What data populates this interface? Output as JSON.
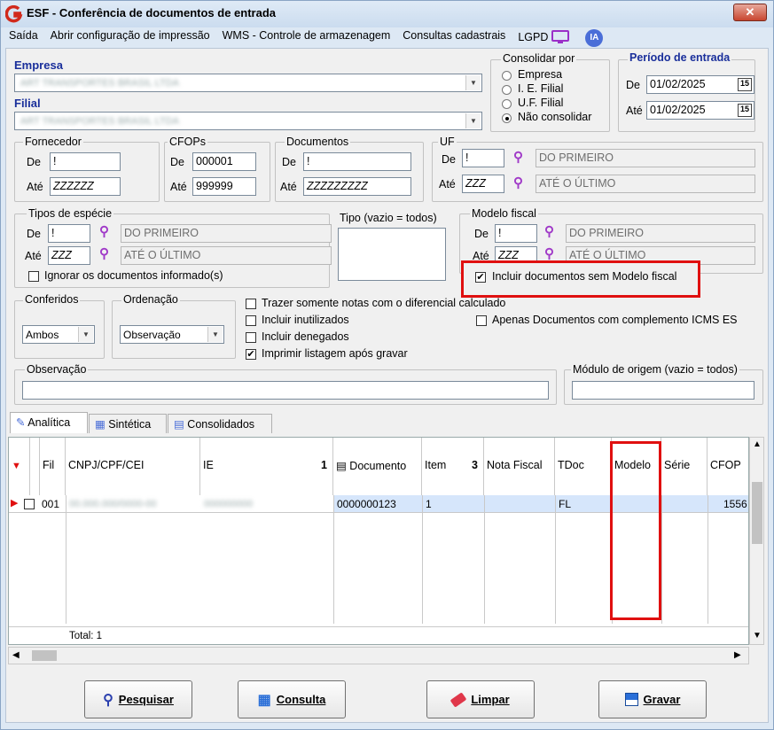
{
  "window": {
    "title": "ESF - Conferência de documentos de entrada",
    "close_symbol": "✕"
  },
  "menu": [
    "Saída",
    "Abrir configuração de impressão",
    "WMS - Controle de armazenagem",
    "Consultas cadastrais",
    "LGPD",
    "IA"
  ],
  "empresa": {
    "label": "Empresa",
    "value": "ART TRANSPORTES BRASIL LTDA"
  },
  "filial": {
    "label": "Filial",
    "value": "ART TRANSPORTES BRASIL LTDA"
  },
  "consolidar": {
    "label": "Consolidar por",
    "options": [
      "Empresa",
      "I. E. Filial",
      "U.F. Filial",
      "Não consolidar"
    ],
    "selected": "Não consolidar"
  },
  "periodo": {
    "label": "Período de entrada",
    "de_label": "De",
    "de": "01/02/2025",
    "ate_label": "Até",
    "ate": "01/02/2025"
  },
  "fornecedor": {
    "label": "Fornecedor",
    "de_label": "De",
    "de": "!",
    "ate_label": "Até",
    "ate": "ZZZZZZ"
  },
  "cfops": {
    "label": "CFOPs",
    "de_label": "De",
    "de": "000001",
    "ate_label": "Até",
    "ate": "999999"
  },
  "documentos": {
    "label": "Documentos",
    "de_label": "De",
    "de": "!",
    "ate_label": "Até",
    "ate": "ZZZZZZZZZ"
  },
  "uf": {
    "label": "UF",
    "de_label": "De",
    "de": "!",
    "de_desc": "DO PRIMEIRO",
    "ate_label": "Até",
    "ate": "ZZZ",
    "ate_desc": "ATÉ O ÚLTIMO"
  },
  "tipos_especie": {
    "label": "Tipos de espécie",
    "de_label": "De",
    "de": "!",
    "de_desc": "DO PRIMEIRO",
    "ate_label": "Até",
    "ate": "ZZZ",
    "ate_desc": "ATÉ O ÚLTIMO",
    "ignorar_label": "Ignorar os documentos informado(s)"
  },
  "tipo": {
    "label": "Tipo (vazio = todos)"
  },
  "modelo_fiscal": {
    "label": "Modelo fiscal",
    "de_label": "De",
    "de": "!",
    "de_desc": "DO PRIMEIRO",
    "ate_label": "Até",
    "ate": "ZZZ",
    "ate_desc": "ATÉ O ÚLTIMO",
    "incluir_label": "Incluir documentos sem Modelo fiscal",
    "incluir_checked": true
  },
  "conferidos": {
    "label": "Conferidos",
    "value": "Ambos"
  },
  "ordenacao": {
    "label": "Ordenação",
    "value": "Observação"
  },
  "options": {
    "trazer": "Trazer somente notas com o diferencial calculado",
    "inutilizados": "Incluir inutilizados",
    "denegados": "Incluir denegados",
    "imprimir": "Imprimir listagem após gravar",
    "imprimir_checked": true,
    "apenas_icms": "Apenas Documentos com complemento ICMS ES"
  },
  "observacao": {
    "label": "Observação"
  },
  "modulo_origem": {
    "label": "Módulo de origem (vazio = todos)"
  },
  "tabs": [
    "Analítica",
    "Sintética",
    "Consolidados"
  ],
  "grid": {
    "columns": [
      "Fil",
      "CNPJ/CPF/CEI",
      "IE",
      "Documento",
      "Item",
      "Nota Fiscal",
      "TDoc",
      "Modelo",
      "Série",
      "CFOP"
    ],
    "sort_ie": "1",
    "sort_item": "3",
    "row": {
      "fil": "001",
      "cnpj": "00.000.000/0000-00",
      "ie": "000000000",
      "documento": "0000000123",
      "item": "1",
      "tdoc": "FL",
      "cfop": "1556"
    },
    "footer": "Total: 1"
  },
  "buttons": {
    "pesquisar": "Pesquisar",
    "consulta": "Consulta",
    "limpar": "Limpar",
    "gravar": "Gravar"
  },
  "colors": {
    "accent": "#1a2f9b",
    "highlight": "#e01010",
    "selected_row": "#d6e6fb"
  }
}
